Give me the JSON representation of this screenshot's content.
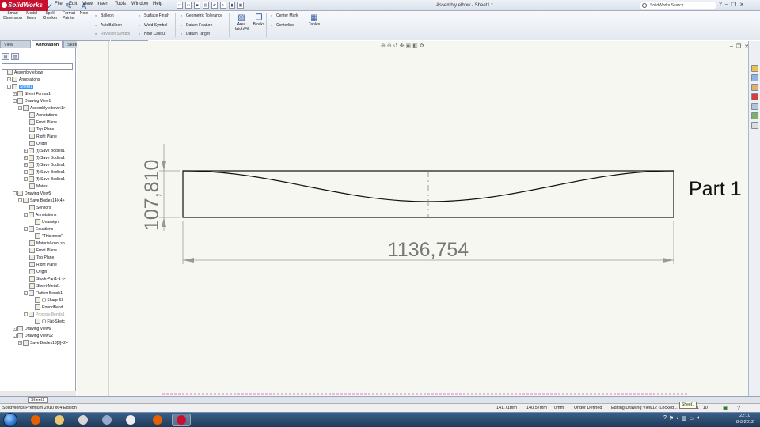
{
  "app": {
    "name": "SolidWorks",
    "title": "Assembly elbow - Sheet1 *"
  },
  "menu": [
    "File",
    "Edit",
    "View",
    "Insert",
    "Tools",
    "Window",
    "Help"
  ],
  "search": {
    "placeholder": "SolidWorks Search"
  },
  "ribbon": {
    "big": [
      {
        "label": "Smart Dimension",
        "icon": "smart-dimension-icon"
      },
      {
        "label": "Model Items",
        "icon": "model-items-icon"
      },
      {
        "label": "Spell Checker",
        "icon": "spell-checker-icon"
      },
      {
        "label": "Format Painter",
        "icon": "format-painter-icon"
      },
      {
        "label": "Note",
        "icon": "note-icon"
      }
    ],
    "col1": [
      {
        "label": "Balloon",
        "icon": "balloon-icon",
        "disabled": false
      },
      {
        "label": "AutoBalloon",
        "icon": "autoballoon-icon",
        "disabled": false
      },
      {
        "label": "Revision Symbol",
        "icon": "revision-symbol-icon",
        "disabled": true
      }
    ],
    "col2": [
      {
        "label": "Surface Finish",
        "icon": "surface-finish-icon",
        "disabled": false
      },
      {
        "label": "Weld Symbol",
        "icon": "weld-symbol-icon",
        "disabled": false
      },
      {
        "label": "Hole Callout",
        "icon": "hole-callout-icon",
        "disabled": false
      }
    ],
    "col3": [
      {
        "label": "Geometric Tolerance",
        "icon": "geometric-tolerance-icon",
        "disabled": false
      },
      {
        "label": "Datum Feature",
        "icon": "datum-feature-icon",
        "disabled": false
      },
      {
        "label": "Datum Target",
        "icon": "datum-target-icon",
        "disabled": false
      }
    ],
    "area_hatch": "Area Hatch/Fill",
    "blocks": "Blocks",
    "col4": [
      {
        "label": "Center Mark",
        "icon": "center-mark-icon"
      },
      {
        "label": "Centerline",
        "icon": "centerline-icon"
      }
    ],
    "tables": "Tables"
  },
  "tabs": [
    {
      "label": "View Layout",
      "active": false
    },
    {
      "label": "Annotation",
      "active": true
    },
    {
      "label": "Sketch",
      "active": false
    },
    {
      "label": "Evaluate",
      "active": false
    },
    {
      "label": "Office Products",
      "active": false
    }
  ],
  "tree": [
    {
      "label": "Assembly elbow",
      "depth": 0,
      "exp": "",
      "disabled": false,
      "selected": false
    },
    {
      "label": "Annotations",
      "depth": 1,
      "exp": "+",
      "disabled": false,
      "selected": false
    },
    {
      "label": "Sheet1",
      "depth": 1,
      "exp": "-",
      "disabled": false,
      "selected": true
    },
    {
      "label": "Sheet Format1",
      "depth": 2,
      "exp": "+",
      "disabled": false,
      "selected": false
    },
    {
      "label": "Drawing View1",
      "depth": 2,
      "exp": "-",
      "disabled": false,
      "selected": false
    },
    {
      "label": "Assembly elbow<1>",
      "depth": 3,
      "exp": "-",
      "disabled": false,
      "selected": false
    },
    {
      "label": "Annotations",
      "depth": 4,
      "exp": "",
      "disabled": false,
      "selected": false
    },
    {
      "label": "Front Plane",
      "depth": 4,
      "exp": "",
      "disabled": false,
      "selected": false
    },
    {
      "label": "Top Plane",
      "depth": 4,
      "exp": "",
      "disabled": false,
      "selected": false
    },
    {
      "label": "Right Plane",
      "depth": 4,
      "exp": "",
      "disabled": false,
      "selected": false
    },
    {
      "label": "Origin",
      "depth": 4,
      "exp": "",
      "disabled": false,
      "selected": false
    },
    {
      "label": "(f) Save Bodies1",
      "depth": 4,
      "exp": "+",
      "disabled": false,
      "selected": false
    },
    {
      "label": "(f) Save Bodies1",
      "depth": 4,
      "exp": "+",
      "disabled": false,
      "selected": false
    },
    {
      "label": "(f) Save Bodies1",
      "depth": 4,
      "exp": "+",
      "disabled": false,
      "selected": false
    },
    {
      "label": "(f) Save Bodies1",
      "depth": 4,
      "exp": "+",
      "disabled": false,
      "selected": false
    },
    {
      "label": "(f) Save Bodies1",
      "depth": 4,
      "exp": "+",
      "disabled": false,
      "selected": false
    },
    {
      "label": "Mates",
      "depth": 4,
      "exp": "",
      "disabled": false,
      "selected": false
    },
    {
      "label": "Drawing View5",
      "depth": 2,
      "exp": "-",
      "disabled": false,
      "selected": false
    },
    {
      "label": "Save Bodies14|<4>",
      "depth": 3,
      "exp": "-",
      "disabled": false,
      "selected": false
    },
    {
      "label": "Sensors",
      "depth": 4,
      "exp": "",
      "disabled": false,
      "selected": false
    },
    {
      "label": "Annotations",
      "depth": 4,
      "exp": "-",
      "disabled": false,
      "selected": false
    },
    {
      "label": "Unassign",
      "depth": 5,
      "exp": "",
      "disabled": false,
      "selected": false
    },
    {
      "label": "Equations",
      "depth": 4,
      "exp": "-",
      "disabled": false,
      "selected": false
    },
    {
      "label": "\"Thickness\"",
      "depth": 5,
      "exp": "",
      "disabled": false,
      "selected": false
    },
    {
      "label": "Material <not sp",
      "depth": 4,
      "exp": "",
      "disabled": false,
      "selected": false
    },
    {
      "label": "Front Plane",
      "depth": 4,
      "exp": "",
      "disabled": false,
      "selected": false
    },
    {
      "label": "Top Plane",
      "depth": 4,
      "exp": "",
      "disabled": false,
      "selected": false
    },
    {
      "label": "Right Plane",
      "depth": 4,
      "exp": "",
      "disabled": false,
      "selected": false
    },
    {
      "label": "Origin",
      "depth": 4,
      "exp": "",
      "disabled": false,
      "selected": false
    },
    {
      "label": "Stock-Part1-1 ->",
      "depth": 4,
      "exp": "",
      "disabled": false,
      "selected": false
    },
    {
      "label": "Sheet-Metal1",
      "depth": 4,
      "exp": "",
      "disabled": false,
      "selected": false
    },
    {
      "label": "Flatten-Bends1",
      "depth": 4,
      "exp": "-",
      "disabled": false,
      "selected": false
    },
    {
      "label": "(-) Sharp-Sk",
      "depth": 5,
      "exp": "",
      "disabled": false,
      "selected": false
    },
    {
      "label": "RoundBend",
      "depth": 5,
      "exp": "",
      "disabled": false,
      "selected": false
    },
    {
      "label": "Process-Bends1",
      "depth": 4,
      "exp": "-",
      "disabled": true,
      "selected": false
    },
    {
      "label": "(-) Flat-Sketc",
      "depth": 5,
      "exp": "",
      "disabled": false,
      "selected": false
    },
    {
      "label": "Drawing View6",
      "depth": 2,
      "exp": "+",
      "disabled": false,
      "selected": false
    },
    {
      "label": "Drawing View12",
      "depth": 2,
      "exp": "-",
      "disabled": false,
      "selected": false
    },
    {
      "label": "Save Bodies13[3]<2>",
      "depth": 3,
      "exp": "+",
      "disabled": false,
      "selected": false
    }
  ],
  "drawing": {
    "vertical_dim": "107,810",
    "horizontal_dim": "1136,754",
    "part_label": "Part 1"
  },
  "sheet_tab": "Sheet1",
  "sheet_tooltip": "Sheet1",
  "status": {
    "edition": "SolidWorks Premium 2010 x64 Edition",
    "x": "141.71mm",
    "y": "140.57mm",
    "z": "0mm",
    "state": "Under Defined",
    "editing": "Editing Drawing View12 (Locked...",
    "scale": "1 : 10"
  },
  "taskbar": {
    "apps": [
      {
        "name": "firefox-icon",
        "color": "#e66000"
      },
      {
        "name": "explorer-icon",
        "color": "#e8c870"
      },
      {
        "name": "media-player-icon",
        "color": "#d8d8d8"
      },
      {
        "name": "network-icon",
        "color": "#9ac"
      },
      {
        "name": "capture-icon",
        "color": "#eeeeee"
      },
      {
        "name": "firefox-icon",
        "color": "#e66000"
      },
      {
        "name": "solidworks-icon",
        "color": "#c8102e"
      }
    ],
    "time": "22:10",
    "date": "8-3-2012"
  }
}
